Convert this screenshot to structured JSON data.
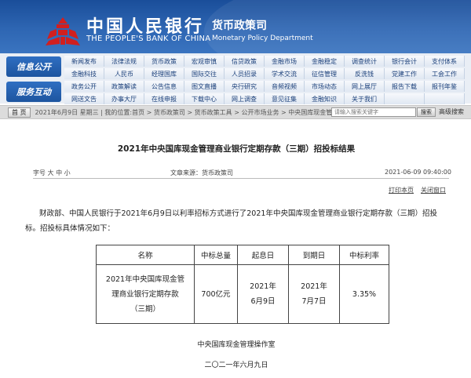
{
  "header": {
    "bank_name_cn": "中国人民银行",
    "bank_name_en": "THE PEOPLE'S BANK OF CHINA",
    "dept_cn": "货币政策司",
    "dept_en": "Monetary Policy Department",
    "logo_icon": "pboc-logo-icon",
    "colors": {
      "banner": "#2e66b3",
      "logo_red": "#d11f1f"
    }
  },
  "nav": {
    "info_label": "信息公开",
    "service_label": "服务互动",
    "rows": [
      [
        "新闻发布",
        "法律法规",
        "货币政策",
        "宏观审慎",
        "信贷政策",
        "金融市场",
        "金融稳定",
        "调查统计",
        "银行会计",
        "支付体系"
      ],
      [
        "金融科技",
        "人民币",
        "经理国库",
        "国际交往",
        "人员招录",
        "学术交流",
        "征信管理",
        "反洗钱",
        "党建工作",
        "工会工作"
      ],
      [
        "政务公开",
        "政策解读",
        "公告信息",
        "图文直播",
        "央行研究",
        "音频视频",
        "市场动态",
        "网上展厅",
        "报告下载",
        "报刊年鉴"
      ],
      [
        "网送文告",
        "办事大厅",
        "在线申报",
        "下载中心",
        "网上调查",
        "意见征集",
        "金融知识",
        "关于我们",
        "",
        ""
      ]
    ]
  },
  "breadcrumb": {
    "home": "首 页",
    "text": "2021年6月9日 星期三 | 我的位置:首页 > 货币政策司 > 货币政策工具 > 公开市场业务 > 中央国库现金管理业务公告",
    "search_placeholder": "请输入搜索关键字",
    "search_button": "搜索",
    "advanced_search": "高级搜索"
  },
  "article": {
    "title": "2021年中央国库现金管理商业银行定期存款（三期）招投标结果",
    "font_size_label": "字号 大 中 小",
    "source": "文章来源：货币政策司",
    "datetime": "2021-06-09 09:40:00",
    "print": "打印本页",
    "close": "关闭窗口",
    "body": "财政部、中国人民银行于2021年6月9日以利率招标方式进行了2021年中央国库现金管理商业银行定期存款（三期）招投标。招投标具体情况如下：",
    "table": {
      "headers": [
        "名称",
        "中标总量",
        "起息日",
        "到期日",
        "中标利率"
      ],
      "row": [
        "2021年中央国库现金管理商业银行定期存款（三期）",
        "700亿元",
        "2021年6月9日",
        "2021年7月7日",
        "3.35%"
      ]
    },
    "signature": "中央国库现金管理操作室",
    "date_cn": "二〇二一年六月九日"
  }
}
